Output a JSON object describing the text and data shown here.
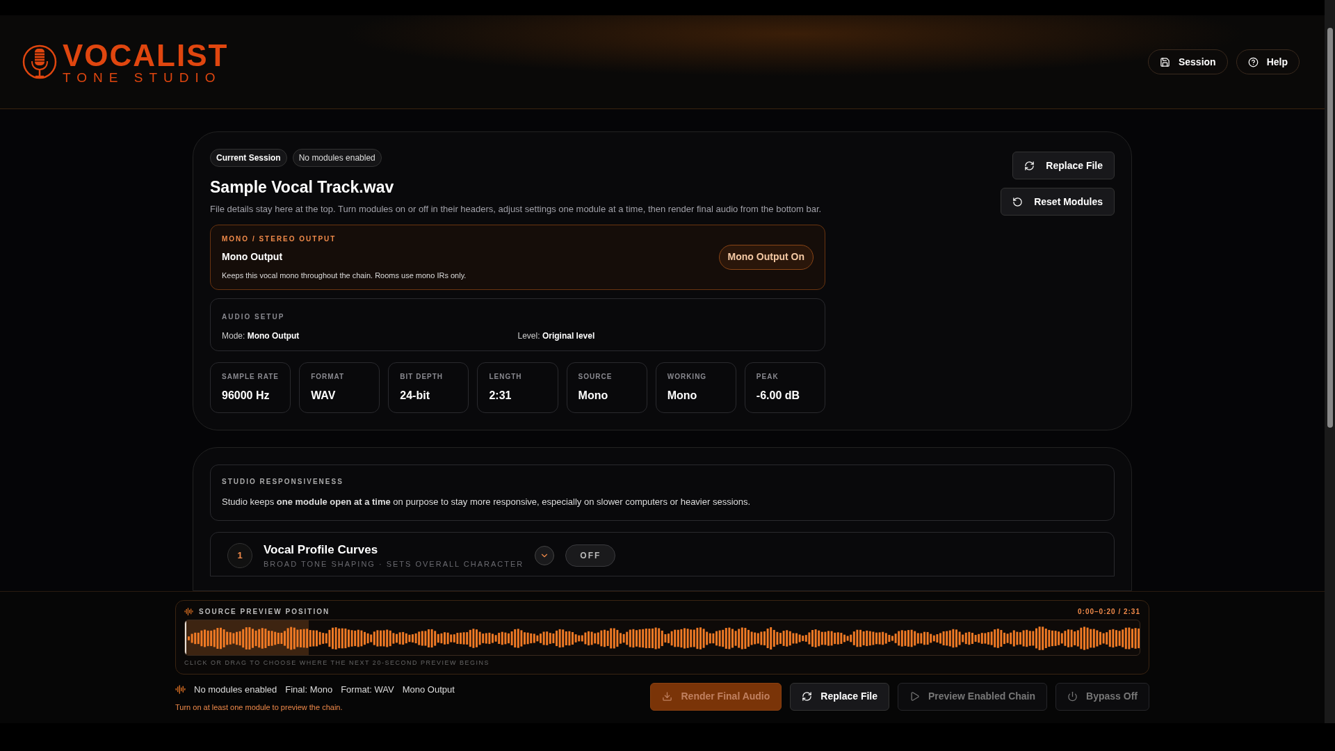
{
  "header": {
    "logo_title": "VOCALIST",
    "logo_subtitle": "TONE STUDIO",
    "buttons": [
      {
        "kind": "session",
        "label": "Session"
      },
      {
        "kind": "help",
        "label": "Help"
      }
    ]
  },
  "file_card": {
    "badges": [
      "Current Session",
      "No modules enabled"
    ],
    "title": "Sample Vocal Track.wav",
    "description": "File details stay here at the top. Turn modules on or off in their headers, adjust settings one module at a time, then render final audio from the bottom bar.",
    "actions": [
      {
        "kind": "replace",
        "label": "Replace File"
      },
      {
        "kind": "reset",
        "label": "Reset Modules"
      }
    ],
    "output": {
      "eyebrow": "MONO / STEREO OUTPUT",
      "title": "Mono Output",
      "note": "Keeps this vocal mono throughout the chain. Rooms use mono IRs only.",
      "toggle_label": "Mono Output On",
      "on": true
    },
    "setup": {
      "eyebrow": "AUDIO SETUP",
      "items": [
        {
          "label": "Mode:",
          "value": "Mono Output"
        },
        {
          "label": "Level:",
          "value": "Original level"
        }
      ]
    },
    "stats": [
      {
        "label": "SAMPLE RATE",
        "value": "96000 Hz"
      },
      {
        "label": "FORMAT",
        "value": "WAV"
      },
      {
        "label": "BIT DEPTH",
        "value": "24-bit"
      },
      {
        "label": "LENGTH",
        "value": "2:31"
      },
      {
        "label": "SOURCE",
        "value": "Mono"
      },
      {
        "label": "WORKING",
        "value": "Mono"
      },
      {
        "label": "PEAK",
        "value": "-6.00 dB"
      }
    ]
  },
  "responsiveness": {
    "eyebrow": "STUDIO RESPONSIVENESS",
    "text": "Studio keeps **one module open at a time** on purpose to stay more responsive, especially on slower computers or heavier sessions."
  },
  "modules": [
    {
      "number": "1",
      "title": "Vocal Profile Curves",
      "subtitle": "BROAD TONE SHAPING · SETS OVERALL CHARACTER",
      "expanded": false,
      "on": false,
      "state_label": "OFF"
    }
  ],
  "preview": {
    "title": "SOURCE PREVIEW POSITION",
    "range": "0:00–0:20 / 2:31",
    "level": 0.13,
    "hint": "CLICK OR DRAG TO CHOOSE WHERE THE NEXT 20-SECOND PREVIEW BEGINS"
  },
  "status": {
    "items": [
      "No modules enabled",
      "Final: Mono",
      "Format: WAV",
      "Mono Output"
    ],
    "warning": "Turn on at least one module to preview the chain."
  },
  "footer_buttons": [
    {
      "kind": "render",
      "label": "Render Final Audio",
      "disabled": true
    },
    {
      "kind": "replace",
      "label": "Replace File",
      "disabled": false
    },
    {
      "kind": "preview",
      "label": "Preview Enabled Chain",
      "disabled": true
    },
    {
      "kind": "bypass",
      "label": "Bypass Off",
      "disabled": true
    }
  ]
}
